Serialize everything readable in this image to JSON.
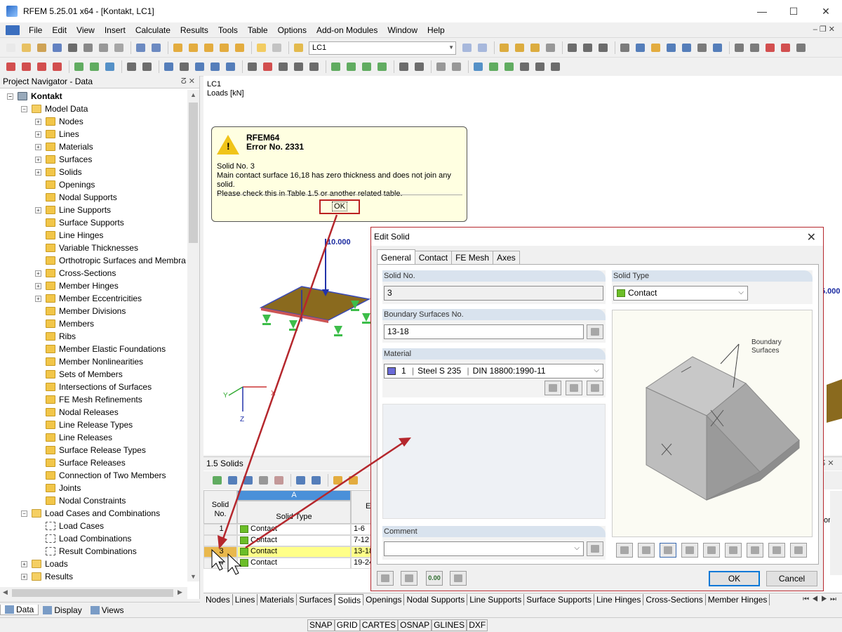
{
  "window": {
    "title": "RFEM 5.25.01 x64 - [Kontakt, LC1]",
    "minimize": "—",
    "maximize": "☐",
    "close": "✕"
  },
  "menu": [
    {
      "label": "File"
    },
    {
      "label": "Edit"
    },
    {
      "label": "View"
    },
    {
      "label": "Insert"
    },
    {
      "label": "Calculate"
    },
    {
      "label": "Results"
    },
    {
      "label": "Tools"
    },
    {
      "label": "Table"
    },
    {
      "label": "Options"
    },
    {
      "label": "Add-on Modules"
    },
    {
      "label": "Window"
    },
    {
      "label": "Help"
    }
  ],
  "toolbar": {
    "loadcase": "LC1"
  },
  "navigator": {
    "title": "Project Navigator - Data",
    "pin": "p ×",
    "items": [
      {
        "label": "Kontakt",
        "level": 0
      },
      {
        "label": "Model Data",
        "level": 1
      },
      {
        "label": "Nodes",
        "level": 2
      },
      {
        "label": "Lines",
        "level": 2
      },
      {
        "label": "Materials",
        "level": 2
      },
      {
        "label": "Surfaces",
        "level": 2
      },
      {
        "label": "Solids",
        "level": 2
      },
      {
        "label": "Openings",
        "level": 2
      },
      {
        "label": "Nodal Supports",
        "level": 2
      },
      {
        "label": "Line Supports",
        "level": 2
      },
      {
        "label": "Surface Supports",
        "level": 2
      },
      {
        "label": "Line Hinges",
        "level": 2
      },
      {
        "label": "Variable Thicknesses",
        "level": 2
      },
      {
        "label": "Orthotropic Surfaces and Membra",
        "level": 2
      },
      {
        "label": "Cross-Sections",
        "level": 2
      },
      {
        "label": "Member Hinges",
        "level": 2
      },
      {
        "label": "Member Eccentricities",
        "level": 2
      },
      {
        "label": "Member Divisions",
        "level": 2
      },
      {
        "label": "Members",
        "level": 2
      },
      {
        "label": "Ribs",
        "level": 2
      },
      {
        "label": "Member Elastic Foundations",
        "level": 2
      },
      {
        "label": "Member Nonlinearities",
        "level": 2
      },
      {
        "label": "Sets of Members",
        "level": 2
      },
      {
        "label": "Intersections of Surfaces",
        "level": 2
      },
      {
        "label": "FE Mesh Refinements",
        "level": 2
      },
      {
        "label": "Nodal Releases",
        "level": 2
      },
      {
        "label": "Line Release Types",
        "level": 2
      },
      {
        "label": "Line Releases",
        "level": 2
      },
      {
        "label": "Surface Release Types",
        "level": 2
      },
      {
        "label": "Surface Releases",
        "level": 2
      },
      {
        "label": "Connection of Two Members",
        "level": 2
      },
      {
        "label": "Joints",
        "level": 2
      },
      {
        "label": "Nodal Constraints",
        "level": 2
      },
      {
        "label": "Load Cases and Combinations",
        "level": 1
      },
      {
        "label": "Load Cases",
        "level": 2
      },
      {
        "label": "Load Combinations",
        "level": 2
      },
      {
        "label": "Result Combinations",
        "level": 2
      },
      {
        "label": "Loads",
        "level": 1
      },
      {
        "label": "Results",
        "level": 1
      }
    ],
    "tabs": [
      {
        "label": "Data"
      },
      {
        "label": "Display"
      },
      {
        "label": "Views"
      }
    ]
  },
  "workspace": {
    "lc": "LC1",
    "loads": "Loads [kN]",
    "load_value": "10.000",
    "load_value_right": "5.000",
    "axis_x": "X",
    "axis_y": "Y",
    "axis_z": "Z"
  },
  "error_dialog": {
    "app": "RFEM64",
    "error": "Error No. 2331",
    "line1": "Solid No. 3",
    "line2": "Main contact surface 16,18 has zero thickness and does not join any solid.",
    "line3": "Please check this in Table 1.5 or another related table.",
    "ok": "OK"
  },
  "solids_table": {
    "title": "1.5 Solids",
    "col_a": "A",
    "col_b": "E",
    "h_no": "Solid\nNo.",
    "h_type": "Solid Type",
    "rows": [
      {
        "no": "1",
        "type": "Contact",
        "b": "1-6"
      },
      {
        "no": "2",
        "type": "Contact",
        "b": "7-12"
      },
      {
        "no": "3",
        "type": "Contact",
        "b": "13-18"
      },
      {
        "no": "4",
        "type": "Contact",
        "b": "19-24"
      }
    ],
    "right_label": "or"
  },
  "bottom_tabs": [
    {
      "label": "Nodes"
    },
    {
      "label": "Lines"
    },
    {
      "label": "Materials"
    },
    {
      "label": "Surfaces"
    },
    {
      "label": "Solids"
    },
    {
      "label": "Openings"
    },
    {
      "label": "Nodal Supports"
    },
    {
      "label": "Line Supports"
    },
    {
      "label": "Surface Supports"
    },
    {
      "label": "Line Hinges"
    },
    {
      "label": "Cross-Sections"
    },
    {
      "label": "Member Hinges"
    }
  ],
  "status": [
    {
      "label": "SNAP"
    },
    {
      "label": "GRID"
    },
    {
      "label": "CARTES"
    },
    {
      "label": "OSNAP"
    },
    {
      "label": "GLINES"
    },
    {
      "label": "DXF"
    }
  ],
  "edit_dialog": {
    "title": "Edit Solid",
    "close": "✕",
    "tabs": [
      {
        "label": "General"
      },
      {
        "label": "Contact"
      },
      {
        "label": "FE Mesh"
      },
      {
        "label": "Axes"
      }
    ],
    "solid_no_label": "Solid No.",
    "solid_no": "3",
    "solid_type_label": "Solid Type",
    "solid_type": "Contact",
    "boundary_label": "Boundary Surfaces No.",
    "boundary": "13-18",
    "material_label": "Material",
    "material_no": "1",
    "material_name": "Steel S 235",
    "material_norm": "DIN 18800:1990-11",
    "comment_label": "Comment",
    "comment": "",
    "preview_label_1": "Boundary",
    "preview_label_2": "Surfaces",
    "ok": "OK",
    "cancel": "Cancel",
    "calc_icon_text": "0.00"
  },
  "colors": {
    "accent_red": "#b5272d",
    "contact_green": "#6cbe28",
    "material_blue": "#6b6bd8",
    "tooltip_bg": "#ffffe1"
  }
}
